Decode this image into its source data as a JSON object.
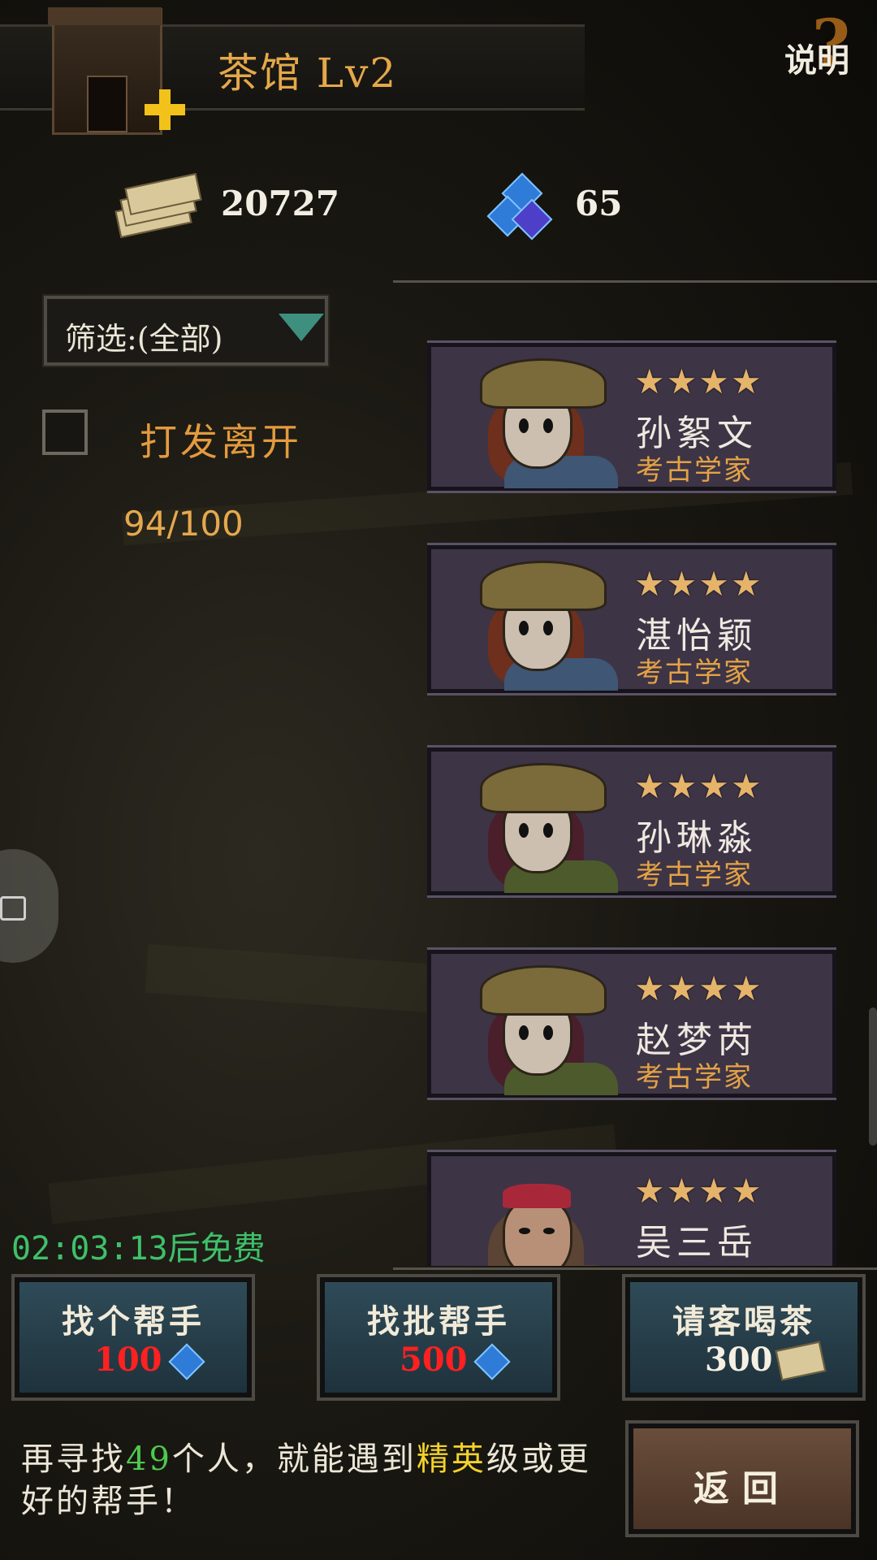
{
  "header": {
    "title": "茶馆  Lv2",
    "help_label": "说明",
    "help_symbol": "?",
    "building_icon": "teahouse-icon",
    "upgrade_icon": "plus-icon"
  },
  "resources": {
    "gold": "20727",
    "gold_icon": "money-stack-icon",
    "gems": "65",
    "gems_icon": "blue-gem-icon"
  },
  "filter": {
    "label": "筛选:(全部)"
  },
  "dismiss": {
    "label": "打发离开",
    "count": "94/100"
  },
  "heroes": [
    {
      "stars": "★★★★",
      "name": "孙絮文",
      "class": "考古学家"
    },
    {
      "stars": "★★★★",
      "name": "湛怡颖",
      "class": "考古学家"
    },
    {
      "stars": "★★★★",
      "name": "孙琳淼",
      "class": "考古学家"
    },
    {
      "stars": "★★★★",
      "name": "赵梦芮",
      "class": "考古学家"
    },
    {
      "stars": "★★★★",
      "name": "吴三岳",
      "class": ""
    }
  ],
  "timer": "02:03:13后免费",
  "buttons": {
    "find_one": {
      "label": "找个帮手",
      "price": "100"
    },
    "find_batch": {
      "label": "找批帮手",
      "price": "500"
    },
    "tea": {
      "label": "请客喝茶",
      "price": "300"
    },
    "back": {
      "label": "返回"
    }
  },
  "message": {
    "part1": "再寻找",
    "count": "49",
    "part2": "个人，就能遇到",
    "rank": "精英",
    "part3": "级或更好的帮手！"
  },
  "colors": {
    "accent_orange": "#e5a84a",
    "price_red": "#ff2020",
    "timer_green": "#3fc06a"
  }
}
